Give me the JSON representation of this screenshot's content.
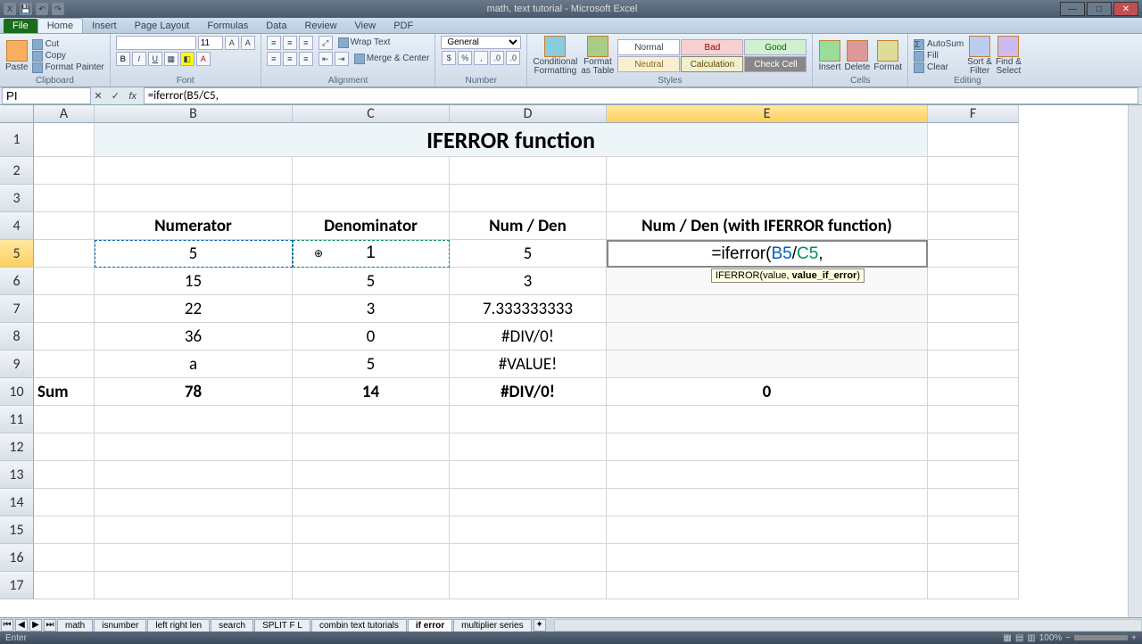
{
  "titlebar": {
    "doc_title": "math, text tutorial - Microsoft Excel"
  },
  "tabs": {
    "file": "File",
    "home": "Home",
    "insert": "Insert",
    "pagelayout": "Page Layout",
    "formulas": "Formulas",
    "data": "Data",
    "review": "Review",
    "view": "View",
    "pdf": "PDF"
  },
  "ribbon": {
    "clipboard": {
      "label": "Clipboard",
      "paste": "Paste",
      "cut": "Cut",
      "copy": "Copy",
      "fp": "Format Painter"
    },
    "font": {
      "label": "Font",
      "size": "11"
    },
    "alignment": {
      "label": "Alignment",
      "wrap": "Wrap Text",
      "merge": "Merge & Center"
    },
    "number": {
      "label": "Number",
      "general": "General"
    },
    "styles": {
      "label": "Styles",
      "cf": "Conditional\nFormatting",
      "ft": "Format\nas Table",
      "normal": "Normal",
      "bad": "Bad",
      "good": "Good",
      "neutral": "Neutral",
      "calc": "Calculation",
      "check": "Check Cell"
    },
    "cells": {
      "label": "Cells",
      "insert": "Insert",
      "delete": "Delete",
      "format": "Format"
    },
    "editing": {
      "label": "Editing",
      "autosum": "AutoSum",
      "fill": "Fill",
      "clear": "Clear",
      "sort": "Sort &\nFilter",
      "find": "Find &\nSelect"
    }
  },
  "namebox": "PI",
  "formula_bar": "=iferror(B5/C5,",
  "columns": {
    "A": "A",
    "B": "B",
    "C": "C",
    "D": "D",
    "E": "E",
    "F": "F"
  },
  "col_widths": {
    "A": 68,
    "B": 222,
    "C": 176,
    "D": 176,
    "E": 360,
    "F": 102
  },
  "rows": [
    "1",
    "2",
    "3",
    "4",
    "5",
    "6",
    "7",
    "8",
    "9",
    "10",
    "11",
    "12",
    "13",
    "14",
    "15",
    "16",
    "17"
  ],
  "cells": {
    "title_r1": "IFERROR function",
    "B4": "Numerator",
    "C4": "Denominator",
    "D4": "Num / Den",
    "E4": "Num / Den (with IFERROR function)",
    "B5": "5",
    "C5": "1",
    "D5": "5",
    "B6": "15",
    "C6": "5",
    "D6": "3",
    "B7": "22",
    "C7": "3",
    "D7": "7.333333333",
    "B8": "36",
    "C8": "0",
    "D8": "#DIV/0!",
    "B9": "a",
    "C9": "5",
    "D9": "#VALUE!",
    "A10": "Sum",
    "B10": "78",
    "C10": "14",
    "D10": "#DIV/0!",
    "E10": "0"
  },
  "editing_cell": {
    "prefix": "=iferror(",
    "refB": "B5",
    "slash": "/",
    "refC": "C5",
    "suffix": ","
  },
  "fn_tooltip": {
    "fn": "IFERROR",
    "sig": "(value, ",
    "bold": "value_if_error",
    "end": ")"
  },
  "sheet_tabs": [
    "math",
    "isnumber",
    "left right len",
    "search",
    "SPLIT F L",
    "combin text tutorials",
    "if error",
    "multiplier series"
  ],
  "active_sheet": "if error",
  "statusbar": {
    "mode": "Enter",
    "zoom": "100%"
  },
  "chart_data": {
    "type": "table",
    "title": "IFERROR function",
    "columns": [
      "Numerator",
      "Denominator",
      "Num / Den",
      "Num / Den (with IFERROR function)"
    ],
    "rows": [
      {
        "Numerator": 5,
        "Denominator": 1,
        "Num / Den": 5
      },
      {
        "Numerator": 15,
        "Denominator": 5,
        "Num / Den": 3
      },
      {
        "Numerator": 22,
        "Denominator": 3,
        "Num / Den": 7.333333333
      },
      {
        "Numerator": 36,
        "Denominator": 0,
        "Num / Den": "#DIV/0!"
      },
      {
        "Numerator": "a",
        "Denominator": 5,
        "Num / Den": "#VALUE!"
      }
    ],
    "sum": {
      "Numerator": 78,
      "Denominator": 14,
      "Num / Den": "#DIV/0!",
      "Num / Den (with IFERROR function)": 0
    }
  }
}
